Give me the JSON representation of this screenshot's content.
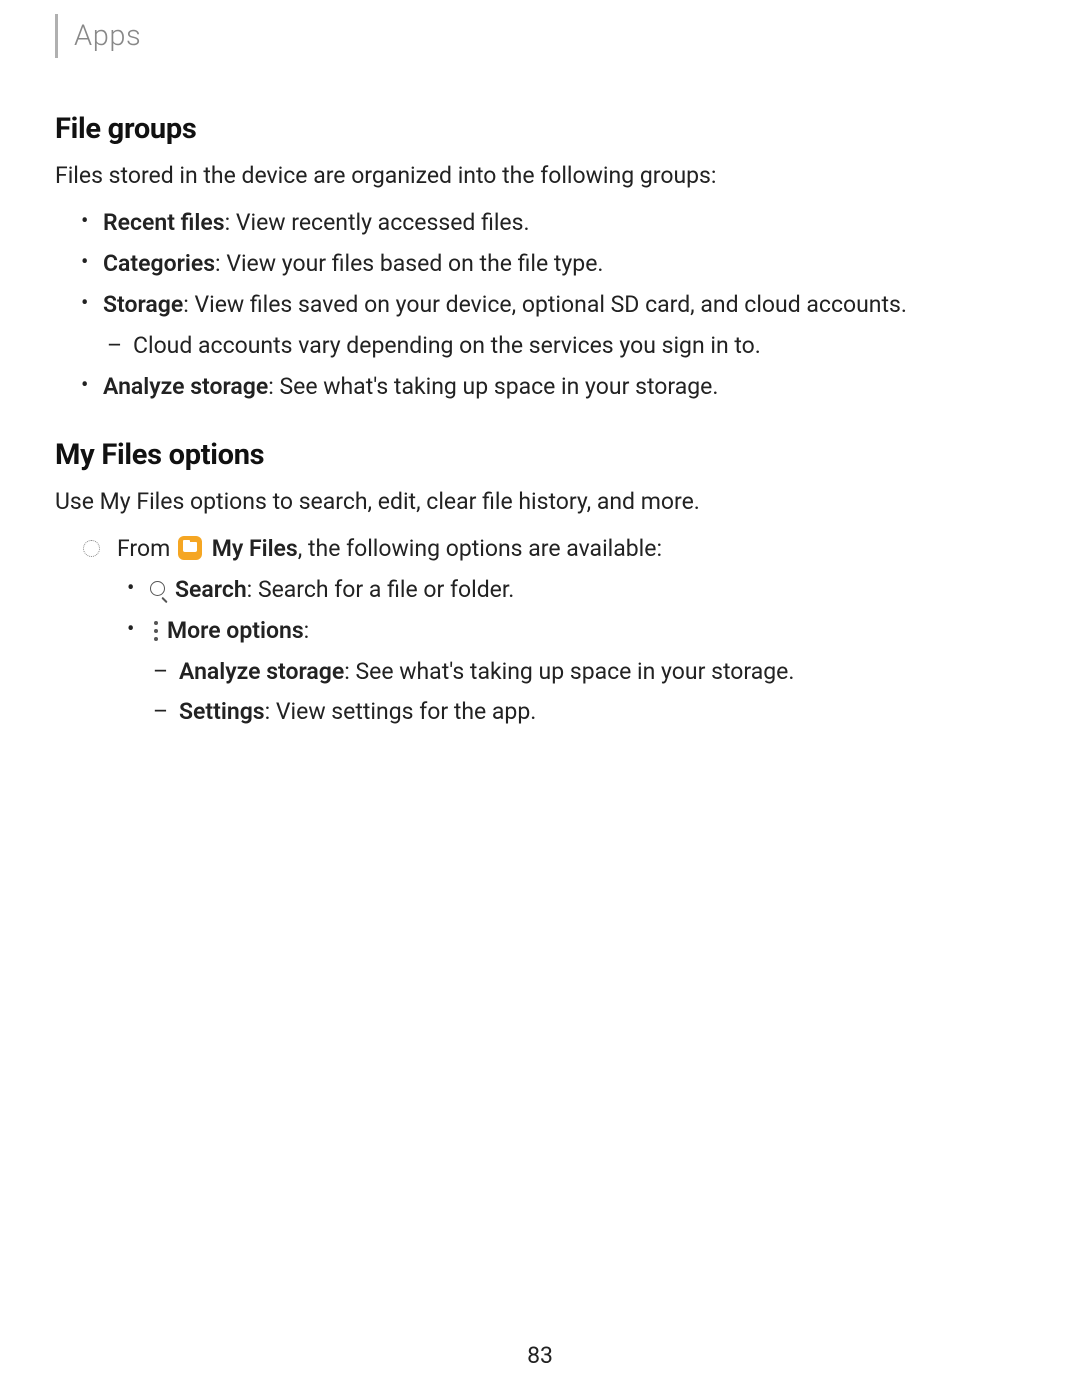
{
  "header": {
    "section_label": "Apps"
  },
  "section1": {
    "heading": "File groups",
    "intro": "Files stored in the device are organized into the following groups:",
    "items": [
      {
        "label": "Recent files",
        "desc": ": View recently accessed files."
      },
      {
        "label": "Categories",
        "desc": ": View your files based on the file type."
      },
      {
        "label": "Storage",
        "desc": ": View files saved on your device, optional SD card, and cloud accounts.",
        "subitems": [
          {
            "text": "Cloud accounts vary depending on the services you sign in to."
          }
        ]
      },
      {
        "label": "Analyze storage",
        "desc": ": See what's taking up space in your storage."
      }
    ]
  },
  "section2": {
    "heading": "My Files options",
    "intro": "Use My Files options to search, edit, clear file history, and more.",
    "from_prefix": "From ",
    "from_app": "My Files",
    "from_suffix": ", the following options are available:",
    "options": [
      {
        "icon": "search",
        "label": "Search",
        "desc": ": Search for a file or folder."
      },
      {
        "icon": "more",
        "label": "More options",
        "desc": ":",
        "subitems": [
          {
            "label": "Analyze storage",
            "desc": ": See what's taking up space in your storage."
          },
          {
            "label": "Settings",
            "desc": ": View settings for the app."
          }
        ]
      }
    ]
  },
  "page_number": "83"
}
